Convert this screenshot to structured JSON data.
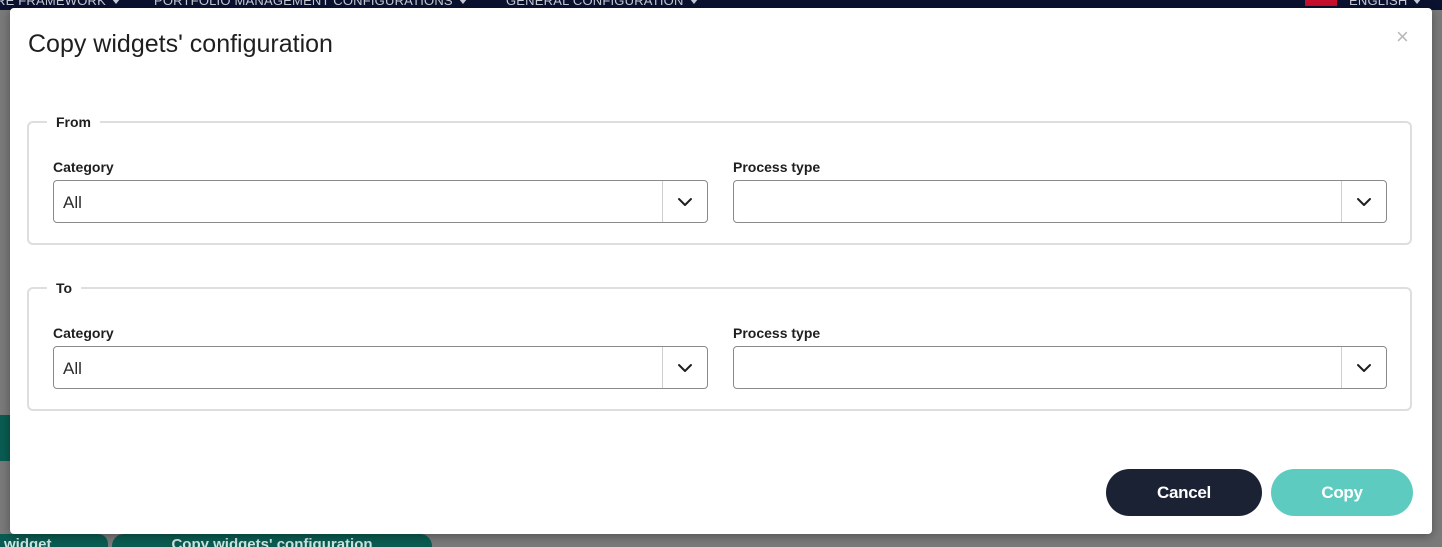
{
  "background": {
    "nav": [
      {
        "label": "RE FRAMEWORK"
      },
      {
        "label": "PORTFOLIO MANAGEMENT CONFIGURATIONS"
      },
      {
        "label": "GENERAL CONFIGURATION"
      }
    ],
    "language": "ENGLISH",
    "buttons": {
      "add_widget": "widget",
      "copy_config": "Copy widgets' configuration"
    }
  },
  "modal": {
    "title": "Copy widgets' configuration",
    "close_label": "×",
    "from": {
      "legend": "From",
      "category_label": "Category",
      "category_value": "All",
      "process_type_label": "Process type",
      "process_type_value": ""
    },
    "to": {
      "legend": "To",
      "category_label": "Category",
      "category_value": "All",
      "process_type_label": "Process type",
      "process_type_value": ""
    },
    "buttons": {
      "cancel": "Cancel",
      "copy": "Copy"
    }
  },
  "colors": {
    "cancel_bg": "#1b2234",
    "copy_bg": "#5ecbc0",
    "nav_bg": "#0a1230",
    "bg_button": "#0a5c52"
  },
  "icons": {
    "dropdown": "chevron-down-icon",
    "close": "close-icon"
  }
}
